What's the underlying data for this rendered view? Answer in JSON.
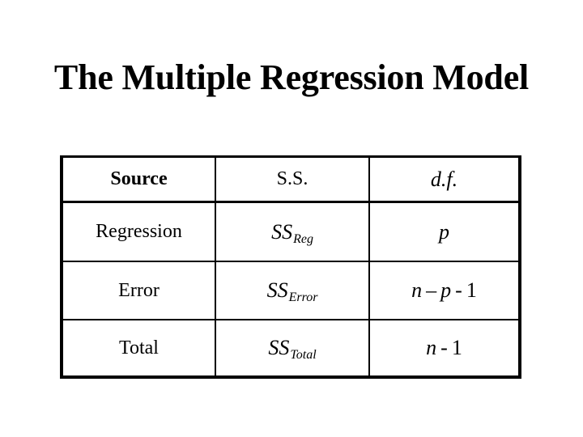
{
  "title": "The Multiple Regression Model",
  "table": {
    "headers": {
      "source": "Source",
      "ss": "S.S.",
      "df": "d.f."
    },
    "rows": [
      {
        "source": "Regression",
        "ss_main": "SS",
        "ss_sub": "Reg",
        "df_parts": [
          "p"
        ]
      },
      {
        "source": "Error",
        "ss_main": "SS",
        "ss_sub": "Error",
        "df_n": "n",
        "df_dash": "–",
        "df_p": "p",
        "df_minus": "-",
        "df_one": "1"
      },
      {
        "source": "Total",
        "ss_main": "SS",
        "ss_sub": "Total",
        "df_n": "n",
        "df_minus": "-",
        "df_one": "1"
      }
    ]
  }
}
